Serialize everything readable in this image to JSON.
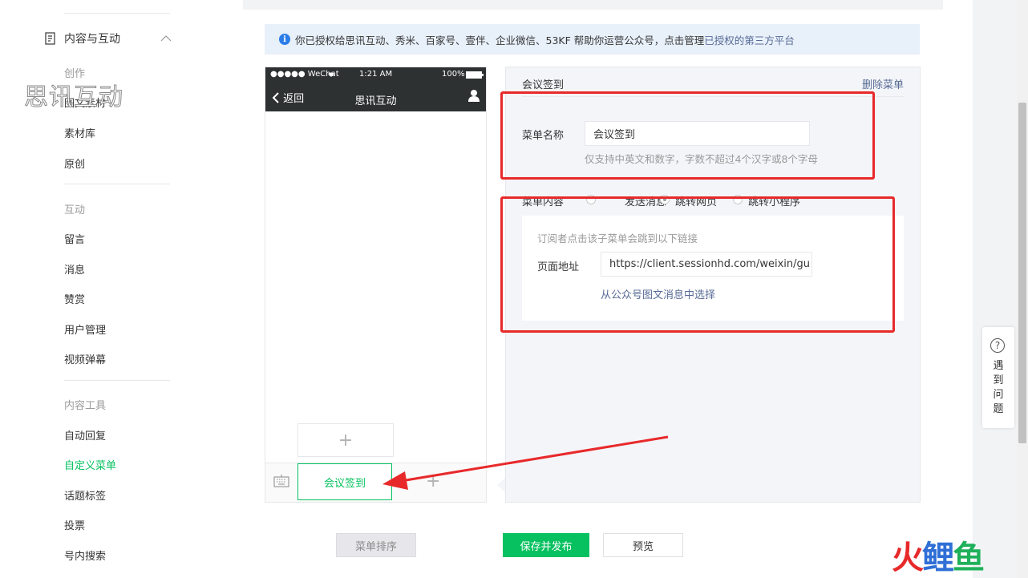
{
  "sidebar": {
    "header_label": "内容与互动",
    "watermark": "思讯互动",
    "sections": [
      {
        "title": "创作",
        "items": [
          "图文素材",
          "素材库",
          "原创"
        ]
      },
      {
        "title": "互动",
        "items": [
          "留言",
          "消息",
          "赞赏",
          "用户管理",
          "视频弹幕"
        ]
      },
      {
        "title": "内容工具",
        "items": [
          "自动回复",
          "自定义菜单",
          "话题标签",
          "投票",
          "号内搜索"
        ]
      }
    ],
    "active_item": "自定义菜单"
  },
  "notice": {
    "text": "你已授权给思讯互动、秀米、百家号、壹伴、企业微信、53KF  帮助你运营公众号，点击管理",
    "link": "已授权的第三方平台"
  },
  "phone": {
    "status_left": "●●●●● WeChat",
    "status_time": "1:21 AM",
    "status_right": "100%",
    "back_label": "返回",
    "title": "思讯互动",
    "menu_item": "会议签到",
    "add_symbol": "+"
  },
  "editor": {
    "title": "会议签到",
    "delete_label": "删除菜单",
    "name_label": "菜单名称",
    "name_value": "会议签到",
    "name_hint": "仅支持中英文和数字，字数不超过4个汉字或8个字母",
    "content_label": "菜单内容",
    "options": [
      "发送消息",
      "跳转网页",
      "跳转小程序"
    ],
    "selected_option": "跳转网页",
    "url_hint": "订阅者点击该子菜单会跳到以下链接",
    "url_label": "页面地址",
    "url_value": "https://client.sessionhd.com/weixin/gu",
    "select_link": "从公众号图文消息中选择"
  },
  "buttons": {
    "sort": "菜单排序",
    "save": "保存并发布",
    "preview": "预览"
  },
  "help": {
    "symbol": "?",
    "text": "遇到问题"
  },
  "brand": {
    "logo_text": "火鲤鱼",
    "colors": {
      "green": "#07c160",
      "link": "#576b95",
      "annotation": "#e8292a"
    }
  }
}
